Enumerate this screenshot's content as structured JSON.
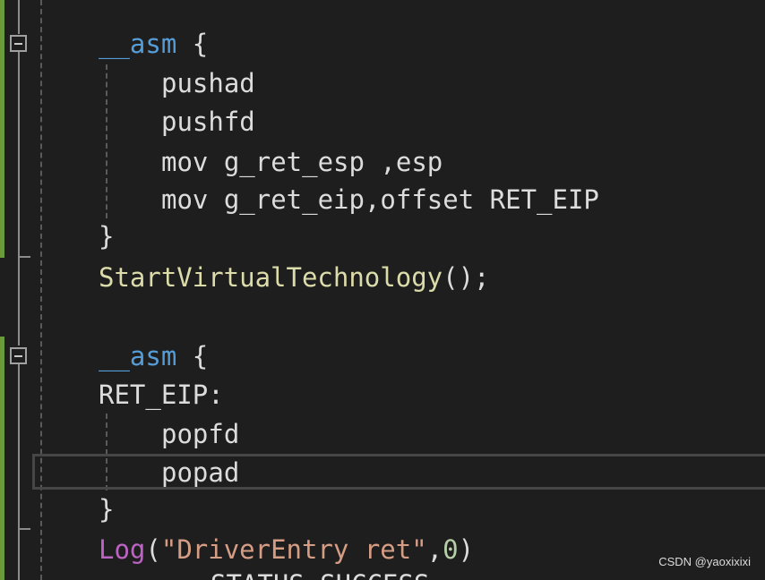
{
  "editor": {
    "lines": {
      "asm1_kw": "__asm",
      "asm1_brace": " {",
      "pushad": "pushad",
      "pushfd": "pushfd",
      "mov1": "mov g_ret_esp ,esp",
      "mov2": "mov g_ret_eip,offset RET_EIP",
      "close1": "}",
      "start_fn": "StartVirtualTechnology",
      "start_rest": "();",
      "asm2_kw": "__asm",
      "asm2_brace": " {",
      "label": "RET_EIP:",
      "popfd": "popfd",
      "popad": "popad",
      "close2": "}",
      "log_fn": "Log",
      "log_open": "(",
      "log_str": "\"DriverEntry ret\"",
      "log_comma": ",",
      "log_num": "0",
      "log_close": ")",
      "partial": "STATUS_SUCCESS"
    },
    "colors": {
      "background": "#1e1e1e",
      "keyword": "#569cd6",
      "function": "#dcdcaa",
      "string": "#d69d85",
      "number": "#b5cea8",
      "change_bar": "#6a9a3a"
    }
  },
  "watermark": "CSDN @yaoxixixi"
}
